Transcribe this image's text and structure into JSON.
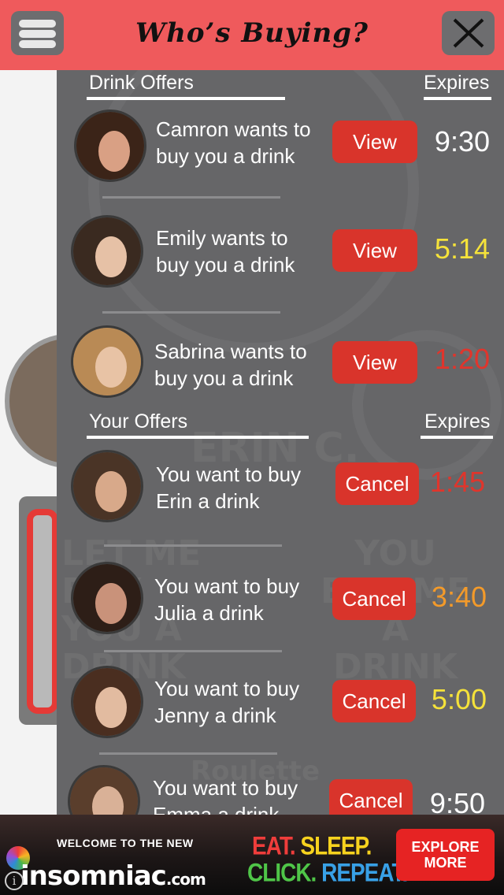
{
  "header": {
    "title": "Who’s Buying?"
  },
  "background": {
    "ghost_name": "ERIN C.",
    "ghost_left_button": "LET ME BUY YOU A DRINK",
    "ghost_right_button": "YOU BUY ME A DRINK",
    "ghost_bottom": "Roulette"
  },
  "drink_offers": {
    "heading": "Drink Offers",
    "expires_label": "Expires",
    "items": [
      {
        "line1": "Camron wants to",
        "line2": "buy you a drink",
        "button": "View",
        "time": "9:30",
        "time_color": "#ffffff",
        "hair": "#3b2418",
        "skin": "#d9a084"
      },
      {
        "line1": "Emily wants to",
        "line2": "buy you a drink",
        "button": "View",
        "time": "5:14",
        "time_color": "#f5e23a",
        "hair": "#3a2a20",
        "skin": "#e6c1a6"
      },
      {
        "line1": "Sabrina wants to",
        "line2": "buy you a drink",
        "button": "View",
        "time": "1:20",
        "time_color": "#e0352c",
        "hair": "#b98a55",
        "skin": "#e8c3a5"
      }
    ]
  },
  "your_offers": {
    "heading": "Your Offers",
    "expires_label": "Expires",
    "items": [
      {
        "line1": "You want to buy",
        "line2": "Erin a drink",
        "button": "Cancel",
        "time": "1:45",
        "time_color": "#e0352c",
        "hair": "#4a3426",
        "skin": "#d8a98a"
      },
      {
        "line1": "You want to buy",
        "line2": "Julia a drink",
        "button": "Cancel",
        "time": "3:40",
        "time_color": "#f39a2a",
        "hair": "#2d1e17",
        "skin": "#c9927a"
      },
      {
        "line1": "You want to buy",
        "line2": "Jenny a drink",
        "button": "Cancel",
        "time": "5:00",
        "time_color": "#f5e23a",
        "hair": "#4a2e20",
        "skin": "#e2bba0"
      },
      {
        "line1": "You want to buy",
        "line2": "Emma a drink",
        "button": "Cancel",
        "time": "9:50",
        "time_color": "#ffffff",
        "hair": "#5a3e2c",
        "skin": "#d9b197"
      }
    ]
  },
  "ad": {
    "welcome": "WELCOME TO THE NEW",
    "brand": "insomniac",
    "brand_suffix": ".com",
    "eat": "EAT.",
    "sleep": "SLEEP.",
    "click": "CLICK.",
    "repeat": "REPEAT.",
    "cta_line1": "EXPLORE",
    "cta_line2": "MORE",
    "info": "i"
  }
}
